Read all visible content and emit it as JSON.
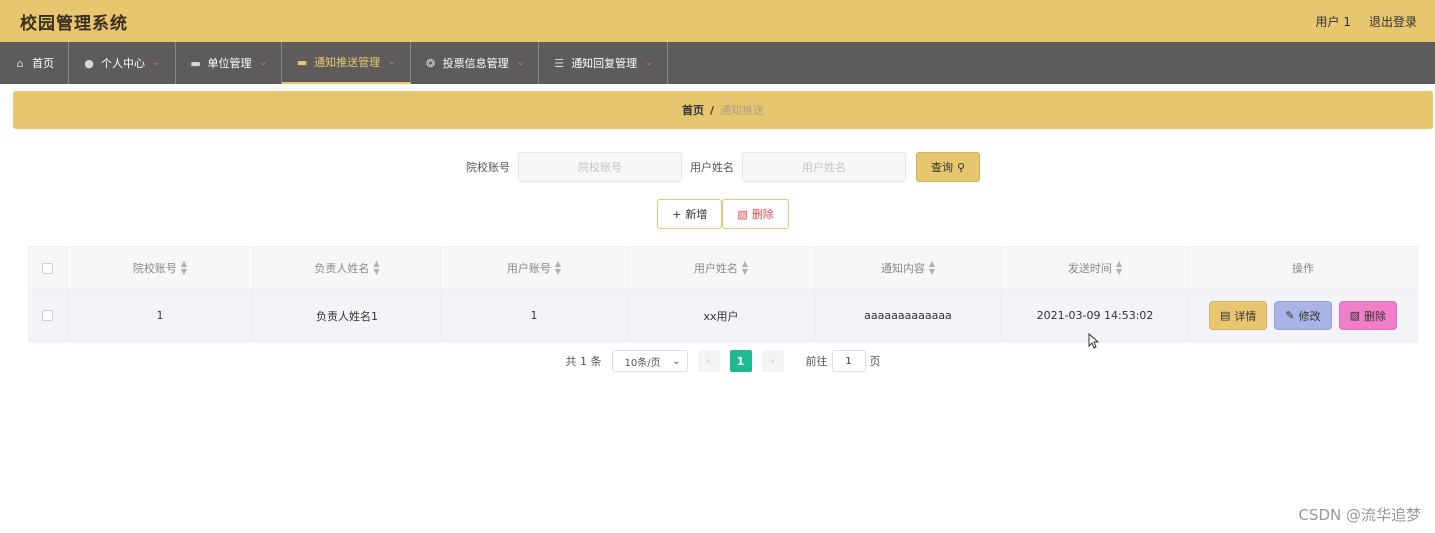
{
  "app": {
    "title": "校园管理系统"
  },
  "top_right": {
    "user": "用户 1",
    "logout": "退出登录"
  },
  "nav": [
    {
      "label": "首页",
      "icon": "home-icon",
      "has_dropdown": false,
      "active": false
    },
    {
      "label": "个人中心",
      "icon": "user-icon",
      "has_dropdown": true,
      "active": false
    },
    {
      "label": "单位管理",
      "icon": "monitor-icon",
      "has_dropdown": true,
      "active": false
    },
    {
      "label": "通知推送管理",
      "icon": "monitor-icon",
      "has_dropdown": true,
      "active": true
    },
    {
      "label": "投票信息管理",
      "icon": "compass-icon",
      "has_dropdown": true,
      "active": false
    },
    {
      "label": "通知回复管理",
      "icon": "list-icon",
      "has_dropdown": true,
      "active": false
    }
  ],
  "breadcrumb": {
    "home": "首页",
    "separator": "/",
    "current": "通知推送"
  },
  "search": {
    "field1_label": "院校账号",
    "field1_placeholder": "院校账号",
    "field2_label": "用户姓名",
    "field2_placeholder": "用户姓名",
    "query_label": "查询"
  },
  "actions": {
    "add_label": "新增",
    "delete_label": "删除"
  },
  "table": {
    "headers": [
      "院校账号",
      "负责人姓名",
      "用户账号",
      "用户姓名",
      "通知内容",
      "发送时间",
      "操作"
    ],
    "rows": [
      {
        "cells": [
          "1",
          "负责人姓名1",
          "1",
          "xx用户",
          "aaaaaaaaaaaaa",
          "2021-03-09 14:53:02"
        ]
      }
    ],
    "op_labels": {
      "detail": "详情",
      "edit": "修改",
      "remove": "删除"
    }
  },
  "pagination": {
    "total_text": "共 1 条",
    "page_size": "10条/页",
    "current_page": "1",
    "goto_prefix": "前往",
    "goto_value": "1",
    "goto_suffix": "页"
  },
  "watermark": "CSDN @流华追梦",
  "colors": {
    "header": "#e8c670",
    "nav": "#5e5c5a",
    "accent_active": "#e8c670",
    "page_active": "#20b890"
  }
}
